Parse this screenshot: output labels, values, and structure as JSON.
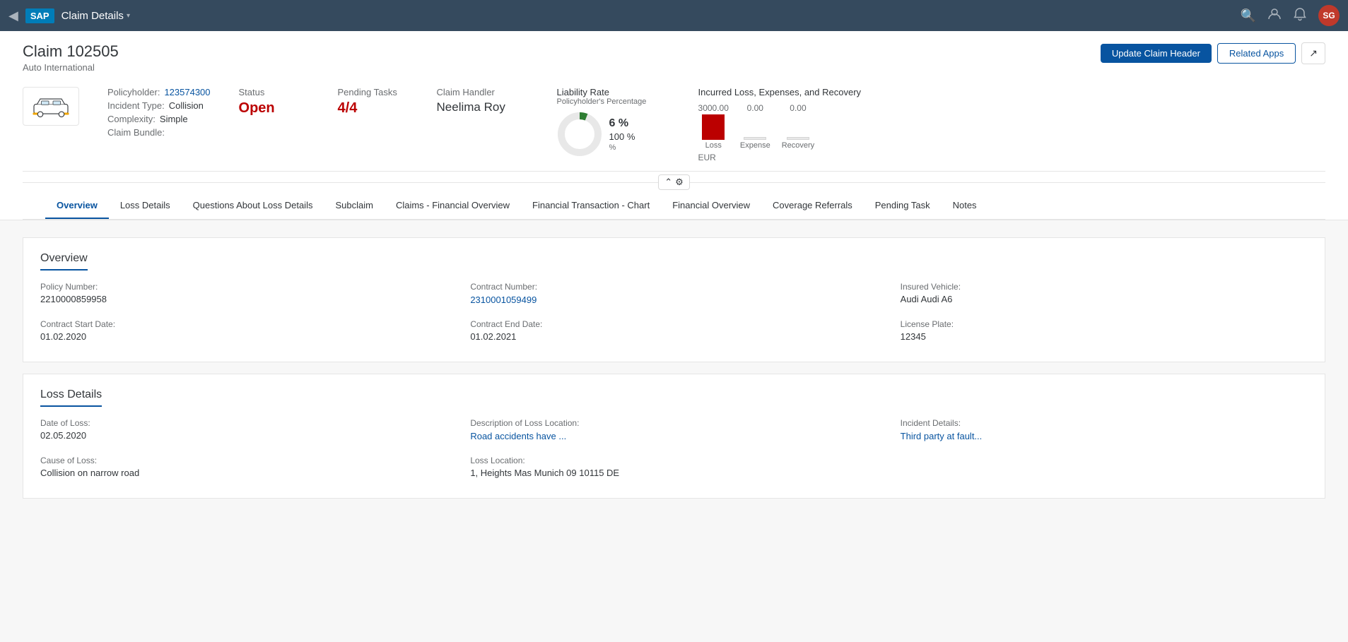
{
  "topnav": {
    "back_icon": "◀",
    "logo": "SAP",
    "title": "Claim Details",
    "chevron": "▾",
    "icons": {
      "search": "🔍",
      "user_settings": "👤",
      "notifications": "🔔"
    },
    "avatar_initials": "SG"
  },
  "claim": {
    "title": "Claim 102505",
    "subtitle": "Auto International",
    "update_btn": "Update Claim Header",
    "related_apps_btn": "Related Apps",
    "external_icon": "↗"
  },
  "claim_info": {
    "policyholder_label": "Policyholder:",
    "policyholder_value": "123574300",
    "incident_label": "Incident Type:",
    "incident_value": "Collision",
    "complexity_label": "Complexity:",
    "complexity_value": "Simple",
    "bundle_label": "Claim Bundle:",
    "bundle_value": "",
    "status_label": "Status",
    "status_value": "Open",
    "pending_tasks_label": "Pending Tasks",
    "pending_tasks_value": "4/4",
    "handler_label": "Claim Handler",
    "handler_value": "Neelima Roy",
    "liability_title": "Liability Rate",
    "liability_subtitle": "Policyholder's Percentage",
    "liability_pct": "6 %",
    "liability_total": "100 %",
    "liability_unit": "%",
    "incurred_title": "Incurred Loss, Expenses, and Recovery",
    "loss_value": "3000.00",
    "expense_value": "0.00",
    "recovery_value": "0.00",
    "loss_label": "Loss",
    "expense_label": "Expense",
    "recovery_label": "Recovery",
    "currency": "EUR"
  },
  "tabs": [
    {
      "id": "overview",
      "label": "Overview",
      "active": true
    },
    {
      "id": "loss-details",
      "label": "Loss Details",
      "active": false
    },
    {
      "id": "questions",
      "label": "Questions About Loss Details",
      "active": false
    },
    {
      "id": "subclaim",
      "label": "Subclaim",
      "active": false
    },
    {
      "id": "claims-financial",
      "label": "Claims - Financial Overview",
      "active": false
    },
    {
      "id": "financial-transaction-chart",
      "label": "Financial Transaction - Chart",
      "active": false
    },
    {
      "id": "financial-overview",
      "label": "Financial Overview",
      "active": false
    },
    {
      "id": "coverage-referrals",
      "label": "Coverage Referrals",
      "active": false
    },
    {
      "id": "pending-task",
      "label": "Pending Task",
      "active": false
    },
    {
      "id": "notes",
      "label": "Notes",
      "active": false
    }
  ],
  "overview_section": {
    "title": "Overview",
    "fields": [
      {
        "label": "Policy Number:",
        "value": "2210000859958",
        "link": false
      },
      {
        "label": "Contract Number:",
        "value": "2310001059499",
        "link": true
      },
      {
        "label": "Insured Vehicle:",
        "value": "Audi Audi A6",
        "link": false
      },
      {
        "label": "Contract Start Date:",
        "value": "01.02.2020",
        "link": false
      },
      {
        "label": "Contract End Date:",
        "value": "01.02.2021",
        "link": false
      },
      {
        "label": "License Plate:",
        "value": "12345",
        "link": false
      }
    ]
  },
  "loss_section": {
    "title": "Loss Details",
    "fields": [
      {
        "label": "Date of Loss:",
        "value": "02.05.2020",
        "link": false
      },
      {
        "label": "Description of Loss Location:",
        "value": "Road accidents have ...",
        "link": true
      },
      {
        "label": "Incident Details:",
        "value": "Third party at fault...",
        "link": true
      },
      {
        "label": "Cause of Loss:",
        "value": "Collision on narrow road",
        "link": false
      },
      {
        "label": "Loss Location:",
        "value": "1, Heights Mas Munich 09 10115 DE",
        "link": false
      },
      {
        "label": "",
        "value": "",
        "link": false
      }
    ]
  }
}
